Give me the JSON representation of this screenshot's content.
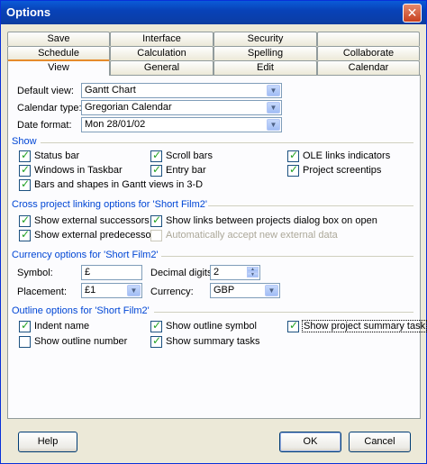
{
  "window": {
    "title": "Options",
    "close_glyph": "✕"
  },
  "tabs": {
    "row1": [
      "Save",
      "Interface",
      "Security",
      ""
    ],
    "row2": [
      "Schedule",
      "Calculation",
      "Spelling",
      "Collaborate"
    ],
    "row3": [
      "View",
      "General",
      "Edit",
      "Calendar"
    ],
    "active": "View"
  },
  "view": {
    "default_view": {
      "label": "Default view:",
      "value": "Gantt Chart"
    },
    "calendar_type": {
      "label": "Calendar type:",
      "value": "Gregorian Calendar"
    },
    "date_format": {
      "label": "Date format:",
      "value": "Mon 28/01/02"
    }
  },
  "show": {
    "heading": "Show",
    "items": [
      {
        "label": "Status bar",
        "checked": true
      },
      {
        "label": "Windows in Taskbar",
        "checked": true
      },
      {
        "label": "Bars and shapes in Gantt views in 3-D",
        "checked": true
      },
      {
        "label": "Scroll bars",
        "checked": true
      },
      {
        "label": "Entry bar",
        "checked": true
      },
      {
        "label": "OLE links indicators",
        "checked": true
      },
      {
        "label": "Project screentips",
        "checked": true
      }
    ]
  },
  "cross_project": {
    "heading": "Cross project linking options for 'Short Film2'",
    "items": [
      {
        "label": "Show external successors",
        "checked": true
      },
      {
        "label": "Show external predecessors",
        "checked": true
      },
      {
        "label": "Show links between projects dialog box on open",
        "checked": true
      },
      {
        "label": "Automatically accept new external data",
        "checked": false,
        "disabled": true
      }
    ]
  },
  "currency": {
    "heading": "Currency options for 'Short Film2'",
    "symbol": {
      "label": "Symbol:",
      "value": "£"
    },
    "placement": {
      "label": "Placement:",
      "value": "£1"
    },
    "decimal_digits": {
      "label": "Decimal digits:",
      "value": "2"
    },
    "currency": {
      "label": "Currency:",
      "value": "GBP"
    }
  },
  "outline": {
    "heading": "Outline options for 'Short Film2'",
    "items": [
      {
        "label": "Indent name",
        "checked": true
      },
      {
        "label": "Show outline number",
        "checked": false
      },
      {
        "label": "Show outline symbol",
        "checked": true
      },
      {
        "label": "Show summary tasks",
        "checked": true
      },
      {
        "label": "Show project summary task",
        "checked": true
      }
    ]
  },
  "buttons": {
    "help": "Help",
    "ok": "OK",
    "cancel": "Cancel"
  },
  "colors": {
    "title_bar": "#0842b8",
    "section_heading": "#0046d5",
    "check": "#21a121"
  }
}
